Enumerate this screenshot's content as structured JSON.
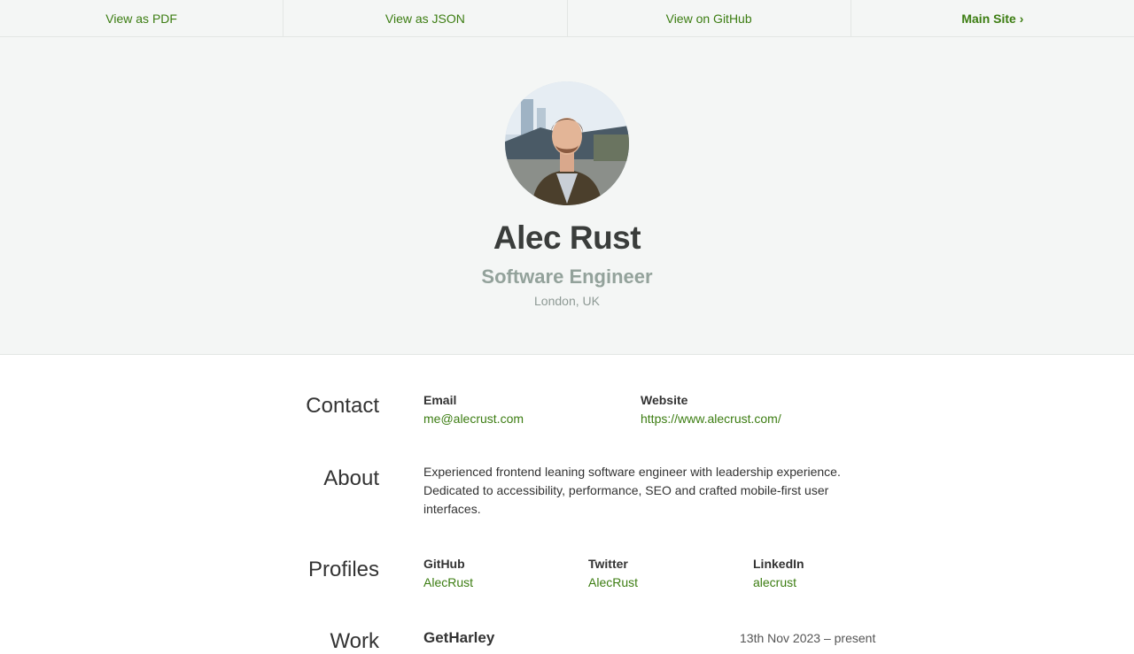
{
  "nav": {
    "pdf": "View as PDF",
    "json": "View as JSON",
    "github": "View on GitHub",
    "main_site": "Main Site ›"
  },
  "profile": {
    "avatar_alt": "portrait photo",
    "name": "Alec Rust",
    "title": "Software Engineer",
    "location": "London, UK"
  },
  "contact": {
    "heading": "Contact",
    "email_label": "Email",
    "email": "me@alecrust.com",
    "website_label": "Website",
    "website": "https://www.alecrust.com/"
  },
  "about": {
    "heading": "About",
    "text": "Experienced frontend leaning software engineer with leadership experience. Dedicated to accessibility, performance, SEO and crafted mobile-first user interfaces."
  },
  "profiles": {
    "heading": "Profiles",
    "items": [
      {
        "network": "GitHub",
        "username": "AlecRust"
      },
      {
        "network": "Twitter",
        "username": "AlecRust"
      },
      {
        "network": "LinkedIn",
        "username": "alecrust"
      }
    ]
  },
  "work": {
    "heading": "Work",
    "company": "GetHarley",
    "date": "13th Nov 2023 – present"
  },
  "colors": {
    "accent": "#3c7d12",
    "hero_bg": "#f4f6f5",
    "muted": "#93a29b"
  }
}
